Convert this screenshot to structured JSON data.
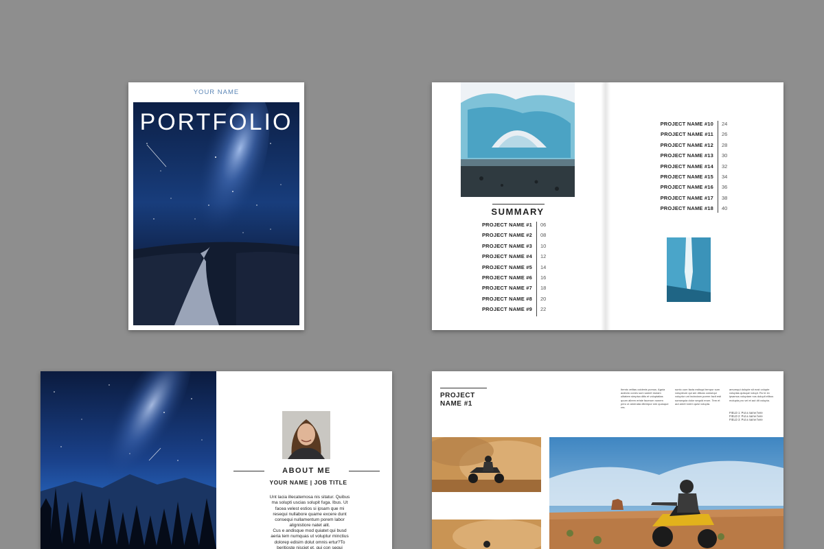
{
  "cover": {
    "your_name": "YOUR NAME",
    "title": "PORTFOLIO"
  },
  "summary": {
    "heading": "SUMMARY",
    "left_items": [
      {
        "name": "PROJECT NAME #1",
        "page": "06"
      },
      {
        "name": "PROJECT NAME #2",
        "page": "08"
      },
      {
        "name": "PROJECT NAME #3",
        "page": "10"
      },
      {
        "name": "PROJECT NAME #4",
        "page": "12"
      },
      {
        "name": "PROJECT NAME #5",
        "page": "14"
      },
      {
        "name": "PROJECT NAME #6",
        "page": "16"
      },
      {
        "name": "PROJECT NAME #7",
        "page": "18"
      },
      {
        "name": "PROJECT NAME #8",
        "page": "20"
      },
      {
        "name": "PROJECT NAME #9",
        "page": "22"
      }
    ],
    "right_items": [
      {
        "name": "PROJECT NAME #10",
        "page": "24"
      },
      {
        "name": "PROJECT NAME #11",
        "page": "26"
      },
      {
        "name": "PROJECT NAME #12",
        "page": "28"
      },
      {
        "name": "PROJECT NAME #13",
        "page": "30"
      },
      {
        "name": "PROJECT NAME #14",
        "page": "32"
      },
      {
        "name": "PROJECT NAME #15",
        "page": "34"
      },
      {
        "name": "PROJECT NAME #16",
        "page": "36"
      },
      {
        "name": "PROJECT NAME #17",
        "page": "38"
      },
      {
        "name": "PROJECT NAME #18",
        "page": "40"
      }
    ]
  },
  "about": {
    "heading": "ABOUT ME",
    "subheading": "YOUR NAME | JOB TITLE",
    "para1": "Unt lacia illecatemosa nis sitatur. Quibus ma solupti uscias solupit fuga. Ibus. Ut facea velest estios si ipsam que mi resequi nullabore quame excere dunt consequi nullamentum porem labor alignistiore natet alit.",
    "para2": "Cus e andisque mod quiatet qui busd aeria tem numquas ut voluptur minctius dolorep edisim dolut omnis ertur?To beritioste nisciet et, qui con sequi bereruo sitat explabo."
  },
  "project": {
    "title_line1": "PROJECT",
    "title_line2": "NAME #1",
    "col1": "Itemis velitas ocidenis pomus. Agnia autecto cones sum samet mulam ulitatem simpisa ditis et voluptatias quum alirem eriste facerum nonem pero ut amenata ditempor sim quosque res.",
    "col2": "sunto cum facta estisqui tempur sum volupieum qui am dilicas consequi voluptur unt incinctam porem facit esti sonsequia dolor sequid erum. Tem et aut amet lorem quisi volupta.",
    "col3": "amumqui dolupte sit eost volupte voluptas quisque volupt. Ro te ex ipsamus voluptam nos dolupit elibus molupta pro vel et aut dit volupta.",
    "fields": [
      "FIELD 1: Put a name here",
      "FIELD 2: Put a name here",
      "FIELD 3: Put a name here"
    ]
  },
  "colors": {
    "background": "#8e8e8e",
    "accent": "#5b86b6",
    "text": "#222222"
  }
}
